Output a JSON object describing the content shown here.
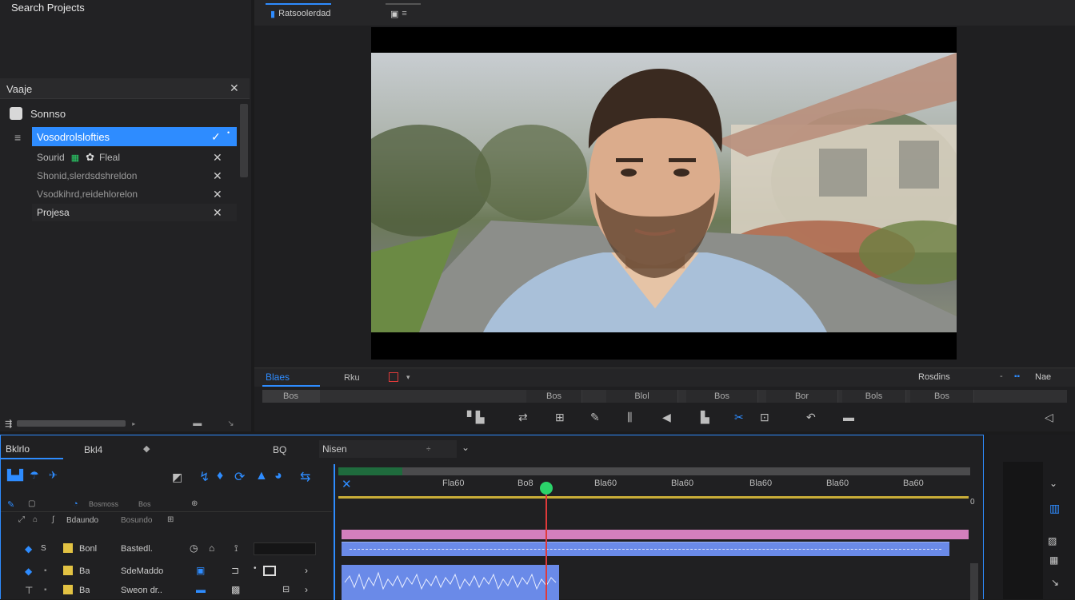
{
  "project_panel": {
    "title": "Search Projects",
    "browser_title": "Vaaje",
    "source_label": "Sonnso",
    "selected_item": "Vosodrolslofties",
    "items": [
      {
        "label": "Sourid",
        "extra": "Fleal"
      },
      {
        "label": "Shonid,slerdsdshreldon"
      },
      {
        "label": "Vsodkihrd,reidehlorelon"
      },
      {
        "label": "Projesa"
      }
    ]
  },
  "monitor": {
    "tab_label": "Ratsoolerdade",
    "tab2_label": "≡",
    "bottom_left_label": "Blaes",
    "bottom_label_2": "Rku",
    "right_label": "Rosdins",
    "right_label_2": "Nae",
    "timecode_segments": [
      "Bos",
      "Bos",
      "Blol",
      "Bos",
      "Bor",
      "Bols",
      "Bos"
    ]
  },
  "timeline": {
    "tab1": "Bklrlo",
    "tab2": "Bkl4",
    "tab3": "BQ",
    "dropdown_value": "Nisen",
    "ruler_marks": [
      "Fla60",
      "Bo8",
      "Bla60",
      "Bla60",
      "Bla60",
      "Bla60",
      "Ba60"
    ],
    "track_headers": [
      {
        "name": "Bonl",
        "desc": "Bastedl."
      },
      {
        "name": "Ba",
        "desc": "SdeMaddo"
      },
      {
        "name": "Ba",
        "desc": "Sweon dr.."
      }
    ],
    "col_headers": [
      "Bosmoss",
      "Bos"
    ],
    "channel_label": "Bdaundo",
    "channel_label_2": "Bosundo"
  },
  "colors": {
    "accent": "#2e8cff",
    "playhead": "#e03a3a",
    "pink_clip": "#d37fbd",
    "blue_clip": "#6a8ae8",
    "green_marker": "#2bd36a"
  }
}
